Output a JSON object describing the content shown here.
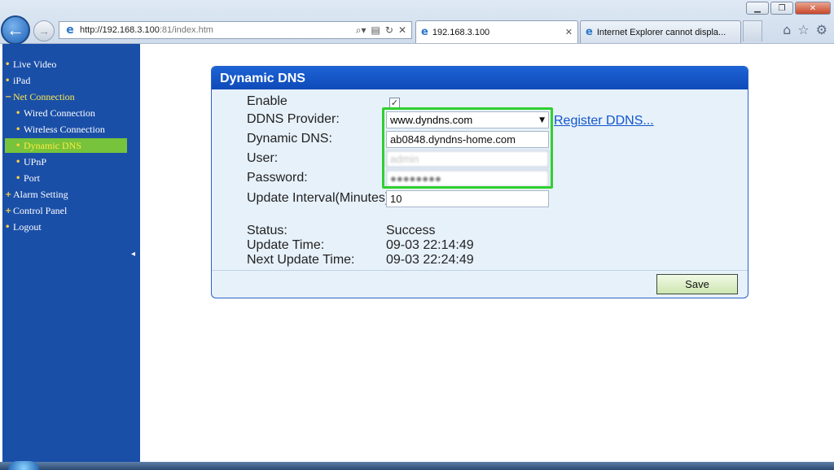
{
  "browser": {
    "url_host": "http://192.168.3.100",
    "url_rest": ":81/index.htm",
    "tabs": [
      {
        "title": "192.168.3.100",
        "active": true
      },
      {
        "title": "Internet Explorer cannot displa...",
        "active": false
      }
    ],
    "icons": [
      "back-arrow-icon",
      "forward-arrow-icon",
      "search-icon",
      "compat-view-icon",
      "refresh-icon",
      "stop-icon",
      "home-icon",
      "favorites-star-icon",
      "settings-gear-icon"
    ]
  },
  "sidebar": {
    "items": [
      {
        "label": "Live Video"
      },
      {
        "label": "iPad"
      },
      {
        "label": "Net Connection"
      },
      {
        "label": "Wired Connection"
      },
      {
        "label": "Wireless Connection"
      },
      {
        "label": "Dynamic DNS"
      },
      {
        "label": "UPnP"
      },
      {
        "label": "Port"
      },
      {
        "label": "Alarm Setting"
      },
      {
        "label": "Control Panel"
      },
      {
        "label": "Logout"
      }
    ],
    "active_color": "#77c33c"
  },
  "panel": {
    "title": "Dynamic DNS",
    "labels": {
      "enable": "Enable",
      "provider": "DDNS Provider:",
      "dynamic_dns": "Dynamic DNS:",
      "user": "User:",
      "password": "Password:",
      "interval": "Update Interval(Minutes):",
      "status": "Status:",
      "update_time": "Update Time:",
      "next_update_time": "Next Update Time:"
    },
    "values": {
      "enable_checked": true,
      "provider": "www.dyndns.com",
      "dynamic_dns": "ab0848.dyndns-home.com",
      "user": "admin",
      "password": "●●●●●●●●",
      "interval": "10",
      "status": "Success",
      "update_time": "09-03 22:14:49",
      "next_update_time": "09-03 22:24:49"
    },
    "register_link": "Register DDNS...",
    "save_label": "Save",
    "highlight_color": "#2fd02f"
  }
}
